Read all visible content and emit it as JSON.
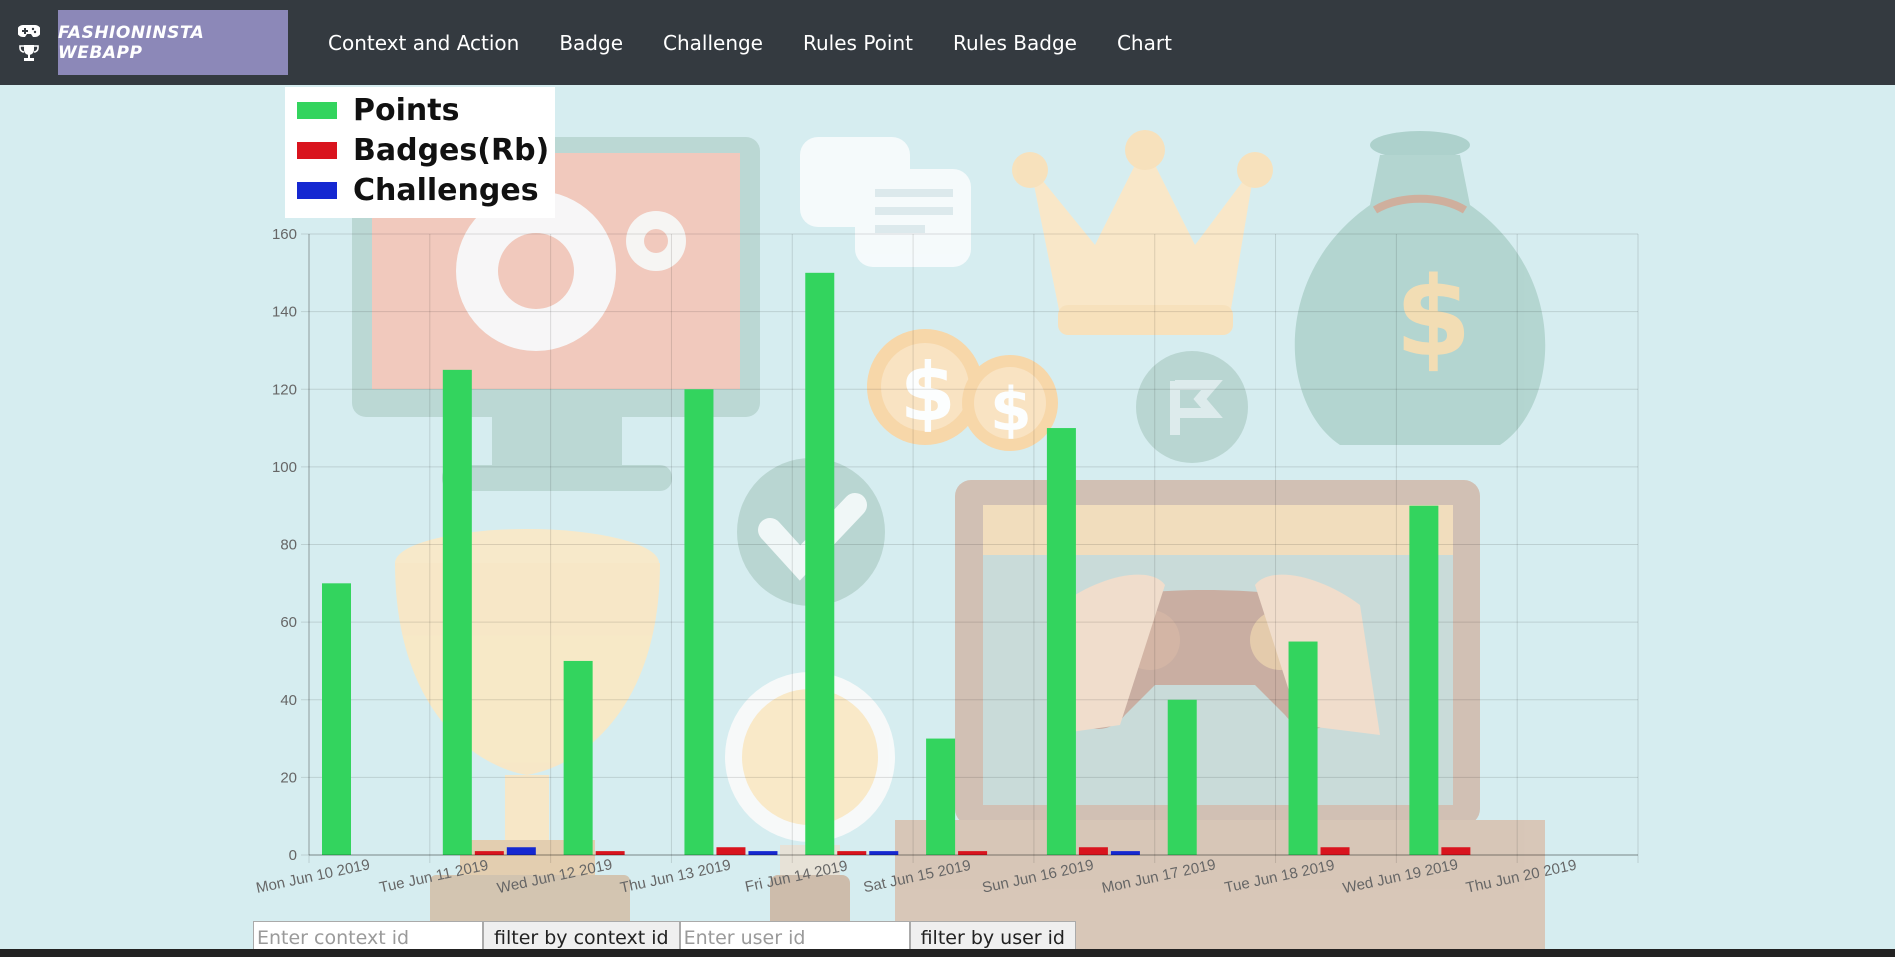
{
  "navbar": {
    "icons": [
      "gamepad-icon",
      "trophy-icon"
    ],
    "brand": "FASHIONINSTA WEBAPP",
    "links": [
      "Context and Action",
      "Badge",
      "Challenge",
      "Rules Point",
      "Rules Badge",
      "Chart"
    ]
  },
  "colors": {
    "navbar_bg": "#343a40",
    "brand_bg": "#8c88b8",
    "page_bg": "#d6edf0",
    "points": "#33d45e",
    "badges": "#d9141e",
    "challenges": "#1528d1"
  },
  "chart_data": {
    "type": "bar",
    "categories": [
      "Mon Jun 10 2019",
      "Tue Jun 11 2019",
      "Wed Jun 12 2019",
      "Thu Jun 13 2019",
      "Fri Jun 14 2019",
      "Sat Jun 15 2019",
      "Sun Jun 16 2019",
      "Mon Jun 17 2019",
      "Tue Jun 18 2019",
      "Wed Jun 19 2019",
      "Thu Jun 20 2019"
    ],
    "series": [
      {
        "name": "Points",
        "color": "#33d45e",
        "values": [
          70,
          125,
          50,
          120,
          150,
          30,
          110,
          40,
          55,
          90,
          0
        ]
      },
      {
        "name": "Badges(Rb)",
        "color": "#d9141e",
        "values": [
          0,
          1,
          1,
          2,
          1,
          1,
          2,
          0,
          2,
          2,
          0
        ]
      },
      {
        "name": "Challenges",
        "color": "#1528d1",
        "values": [
          0,
          2,
          0,
          1,
          1,
          0,
          1,
          0,
          0,
          0,
          0
        ]
      }
    ],
    "yticks": [
      "0",
      "20",
      "40",
      "60",
      "80",
      "100",
      "120",
      "140",
      "160"
    ],
    "ylim": [
      0,
      160
    ],
    "grid": true,
    "legend": "top-left"
  },
  "filters": {
    "context_placeholder": "Enter context id",
    "context_button": "filter by context id",
    "user_placeholder": "Enter user id",
    "user_button": "filter by user id"
  }
}
